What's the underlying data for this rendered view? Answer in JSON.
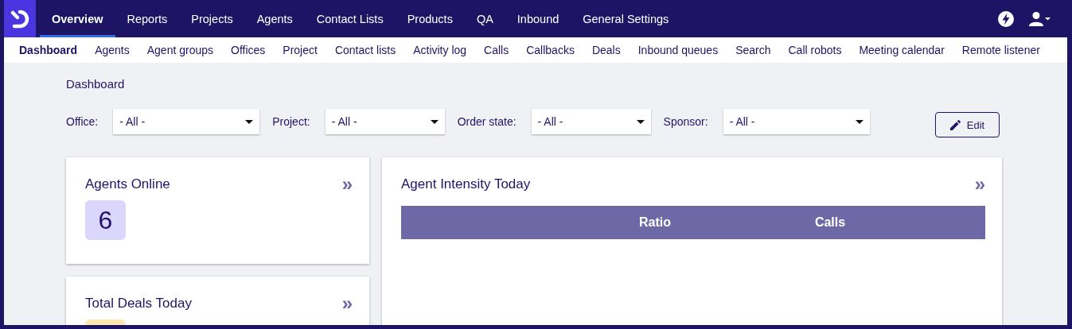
{
  "top_nav": {
    "items": [
      {
        "label": "Overview",
        "selected": true
      },
      {
        "label": "Reports",
        "selected": false
      },
      {
        "label": "Projects",
        "selected": false
      },
      {
        "label": "Agents",
        "selected": false
      },
      {
        "label": "Contact Lists",
        "selected": false
      },
      {
        "label": "Products",
        "selected": false
      },
      {
        "label": "QA",
        "selected": false
      },
      {
        "label": "Inbound",
        "selected": false
      },
      {
        "label": "General Settings",
        "selected": false
      }
    ]
  },
  "sub_nav": {
    "items": [
      {
        "label": "Dashboard",
        "selected": true
      },
      {
        "label": "Agents",
        "selected": false
      },
      {
        "label": "Agent groups",
        "selected": false
      },
      {
        "label": "Offices",
        "selected": false
      },
      {
        "label": "Project",
        "selected": false
      },
      {
        "label": "Contact lists",
        "selected": false
      },
      {
        "label": "Activity log",
        "selected": false
      },
      {
        "label": "Calls",
        "selected": false
      },
      {
        "label": "Callbacks",
        "selected": false
      },
      {
        "label": "Deals",
        "selected": false
      },
      {
        "label": "Inbound queues",
        "selected": false
      },
      {
        "label": "Search",
        "selected": false
      },
      {
        "label": "Call robots",
        "selected": false
      },
      {
        "label": "Meeting calendar",
        "selected": false
      },
      {
        "label": "Remote listener",
        "selected": false
      }
    ]
  },
  "page_title": "Dashboard",
  "filters": [
    {
      "label": "Office:",
      "value": "- All -"
    },
    {
      "label": "Project:",
      "value": "- All -"
    },
    {
      "label": "Order state:",
      "value": "- All -"
    },
    {
      "label": "Sponsor:",
      "value": "- All -"
    }
  ],
  "edit_button": "Edit",
  "stat_cards": [
    {
      "title": "Agents Online",
      "value": "6",
      "color": "#dbd6fb",
      "expand": "»"
    },
    {
      "title": "Total Deals Today",
      "color": "#fde8b0",
      "expand": "»"
    }
  ],
  "intensity_card": {
    "title": "Agent Intensity Today",
    "expand": "»",
    "columns": [
      "Ratio",
      "Calls"
    ]
  }
}
